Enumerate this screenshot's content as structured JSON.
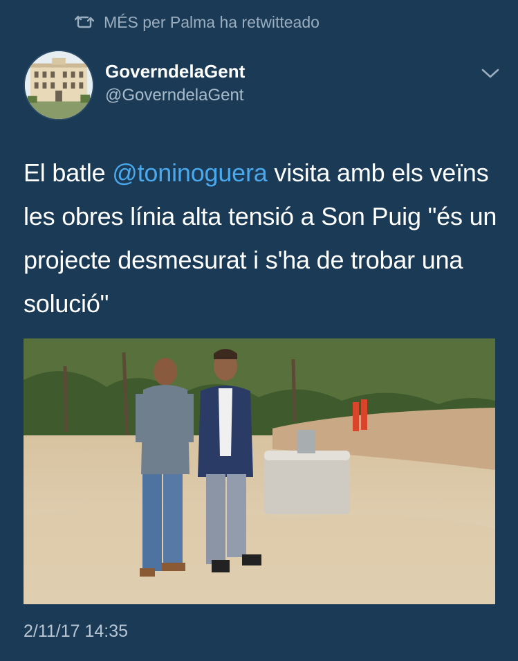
{
  "retweet": {
    "icon": "retweet-icon",
    "text": "MÉS per Palma ha retwitteado"
  },
  "author": {
    "display_name": "GoverndelaGent",
    "handle": "@GoverndelaGent",
    "avatar": "building-avatar"
  },
  "menu": {
    "icon": "chevron-down-icon"
  },
  "tweet": {
    "text_before": "El batle ",
    "mention": "@toninoguera",
    "text_after": " visita amb els veïns les obres línia alta tensió a Son Puig \"és un projecte desmesurat i s'ha de trobar una solució\""
  },
  "media": {
    "type": "photo"
  },
  "timestamp": "2/11/17 14:35",
  "colors": {
    "background": "#1b3a55",
    "mention": "#4aa8ec",
    "secondary_text": "#9aaebf"
  }
}
